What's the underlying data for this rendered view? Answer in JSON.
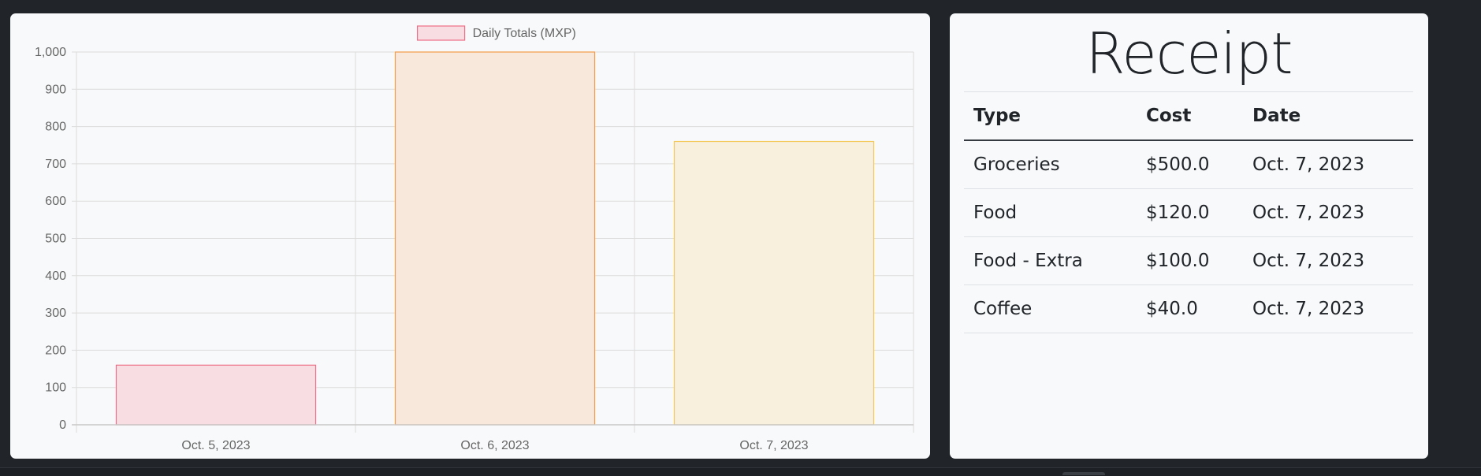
{
  "chart_data": {
    "type": "bar",
    "categories": [
      "Oct. 5, 2023",
      "Oct. 6, 2023",
      "Oct. 7, 2023"
    ],
    "series": [
      {
        "name": "Daily Totals (MXP)",
        "values": [
          160,
          1000,
          760
        ]
      }
    ],
    "ylim": [
      0,
      1000
    ],
    "yticks": [
      "0",
      "100",
      "200",
      "300",
      "400",
      "500",
      "600",
      "700",
      "800",
      "900",
      "1,000"
    ],
    "grid": true,
    "legend": "top-center",
    "bar_colors": [
      {
        "fill": "#f8dde3",
        "stroke": "#ee6f87"
      },
      {
        "fill": "#f8e8db",
        "stroke": "#f59a47"
      },
      {
        "fill": "#f8f0dd",
        "stroke": "#f5c85a"
      }
    ],
    "legend_swatch": {
      "fill": "#f8dde3",
      "stroke": "#ee6f87"
    }
  },
  "receipt": {
    "title": "Receipt",
    "headers": {
      "type": "Type",
      "cost": "Cost",
      "date": "Date"
    },
    "rows": [
      {
        "type": "Groceries",
        "cost": "$500.0",
        "date": "Oct. 7, 2023"
      },
      {
        "type": "Food",
        "cost": "$120.0",
        "date": "Oct. 7, 2023"
      },
      {
        "type": "Food - Extra",
        "cost": "$100.0",
        "date": "Oct. 7, 2023"
      },
      {
        "type": "Coffee",
        "cost": "$40.0",
        "date": "Oct. 7, 2023"
      }
    ]
  }
}
